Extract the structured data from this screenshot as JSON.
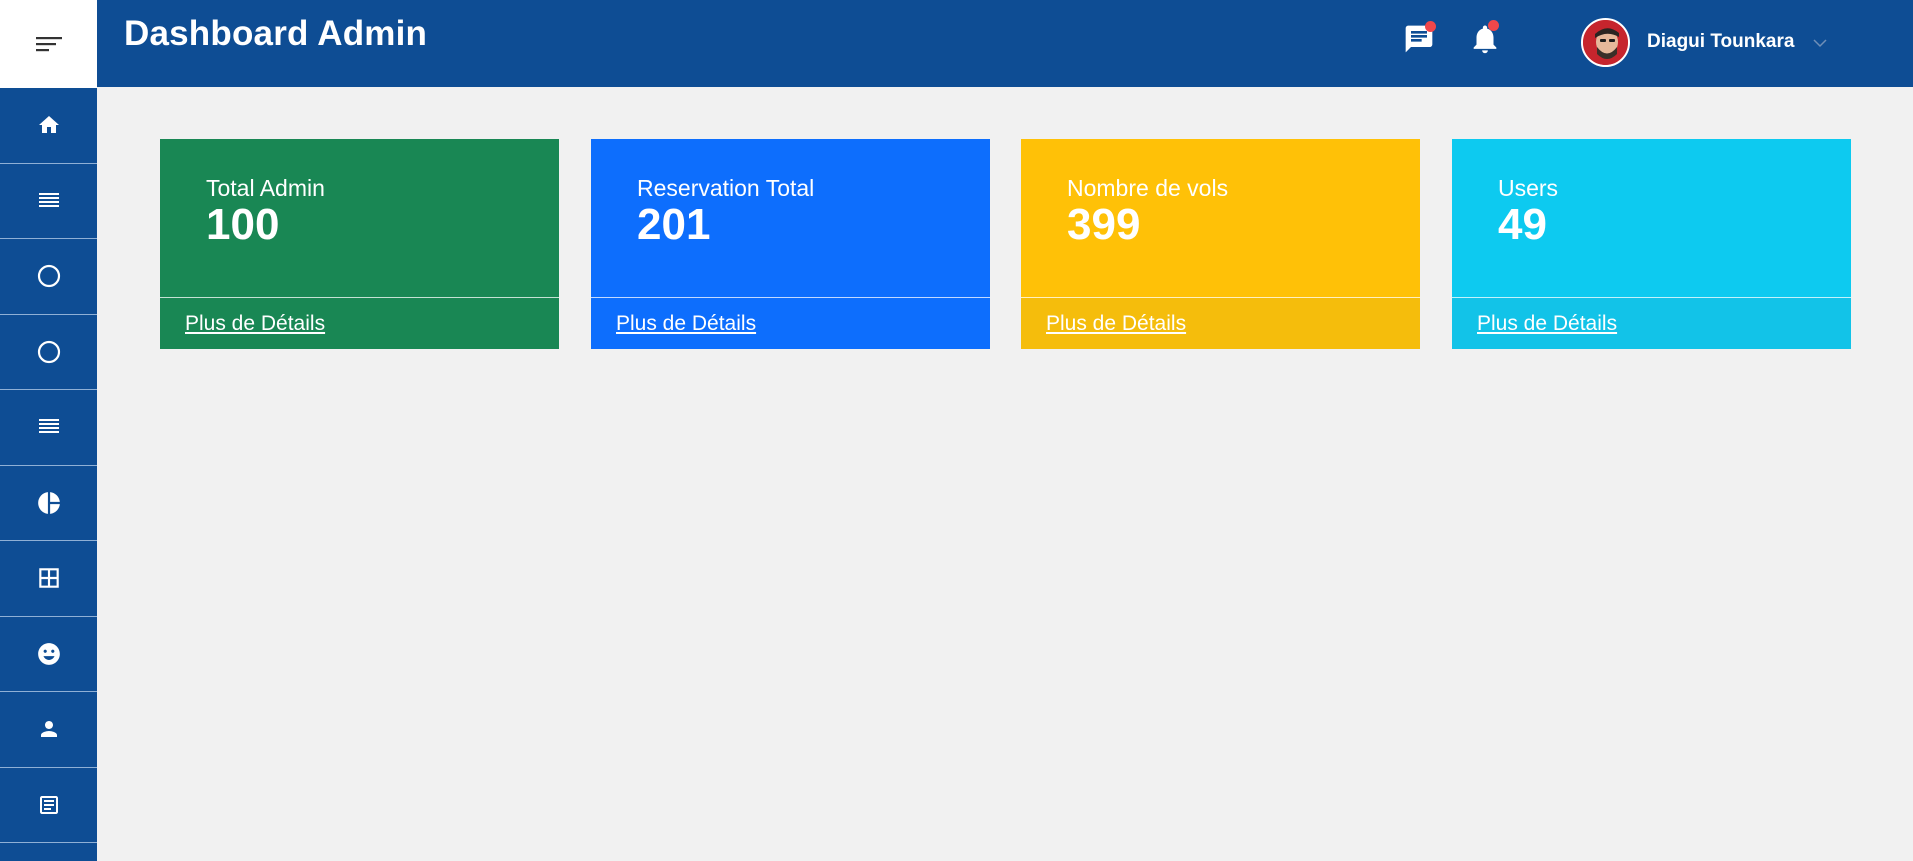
{
  "header": {
    "title": "Dashboard Admin",
    "user_name": "Diagui Tounkara",
    "messages_icon": "message-icon",
    "notifications_icon": "bell-icon"
  },
  "sidebar": {
    "toggle_icon": "menu-toggle-icon",
    "items": [
      {
        "icon": "home-icon"
      },
      {
        "icon": "list-icon"
      },
      {
        "icon": "circle-icon"
      },
      {
        "icon": "circle-icon"
      },
      {
        "icon": "list-icon"
      },
      {
        "icon": "pie-chart-icon"
      },
      {
        "icon": "grid-icon"
      },
      {
        "icon": "smiley-icon"
      },
      {
        "icon": "user-icon"
      },
      {
        "icon": "document-icon"
      }
    ]
  },
  "cards": [
    {
      "label": "Total Admin",
      "value": "100",
      "link": "Plus de Détails",
      "color": "#198754",
      "footer_color": "#198754"
    },
    {
      "label": "Reservation Total",
      "value": "201",
      "link": "Plus de Détails",
      "color": "#0d6efd",
      "footer_color": "#0d6efd"
    },
    {
      "label": "Nombre de vols",
      "value": "399",
      "link": "Plus de Détails",
      "color": "#ffc107",
      "footer_color": "#f5bd0c"
    },
    {
      "label": "Users",
      "value": "49",
      "link": "Plus de Détails",
      "color": "#0dcaf0",
      "footer_color": "#12c3e8"
    }
  ],
  "colors": {
    "primary": "#0e4d94",
    "background": "#f1f1f1",
    "notification_dot": "#f0474a"
  }
}
